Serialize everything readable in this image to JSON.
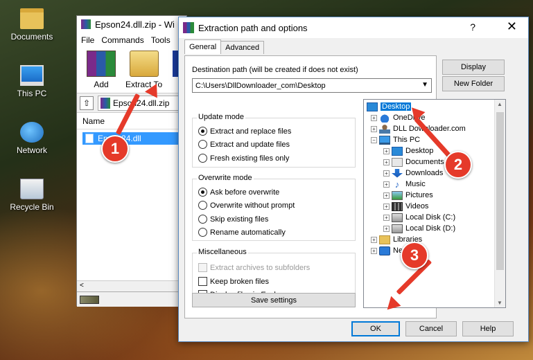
{
  "desktop": {
    "icons": [
      {
        "label": "Documents"
      },
      {
        "label": "This PC"
      },
      {
        "label": "Network"
      },
      {
        "label": "Recycle Bin"
      }
    ]
  },
  "winrar": {
    "title": "Epson24.dll.zip - Wi",
    "menu": [
      "File",
      "Commands",
      "Tools"
    ],
    "toolbar": {
      "add": "Add",
      "extract_to": "Extract To",
      "test": "T"
    },
    "path": "Epson24.dll.zip",
    "column_name": "Name",
    "file": "Epson24.dll",
    "hscroll_left": "<"
  },
  "dialog": {
    "title": "Extraction path and options",
    "help": "?",
    "close": "✕",
    "tabs": [
      "General",
      "Advanced"
    ],
    "dest_label": "Destination path (will be created if does not exist)",
    "dest_value": "C:\\Users\\DllDownloader_com\\Desktop",
    "display_btn": "Display",
    "new_folder_btn": "New Folder",
    "update_mode": {
      "title": "Update mode",
      "options": [
        "Extract and replace files",
        "Extract and update files",
        "Fresh existing files only"
      ],
      "selected": 0
    },
    "overwrite_mode": {
      "title": "Overwrite mode",
      "options": [
        "Ask before overwrite",
        "Overwrite without prompt",
        "Skip existing files",
        "Rename automatically"
      ],
      "selected": 0
    },
    "misc": {
      "title": "Miscellaneous",
      "options": [
        "Extract archives to subfolders",
        "Keep broken files",
        "Display files in Explorer"
      ]
    },
    "save_settings": "Save settings",
    "ok": "OK",
    "cancel": "Cancel",
    "help_btn": "Help",
    "tree": [
      {
        "label": "Desktop",
        "selected": true
      },
      {
        "label": "OneDrive"
      },
      {
        "label": "DLL Downloader.com"
      },
      {
        "label": "This PC"
      },
      {
        "label": "Desktop"
      },
      {
        "label": "Documents"
      },
      {
        "label": "Downloads"
      },
      {
        "label": "Music"
      },
      {
        "label": "Pictures"
      },
      {
        "label": "Videos"
      },
      {
        "label": "Local Disk (C:)"
      },
      {
        "label": "Local Disk (D:)"
      },
      {
        "label": "Libraries"
      },
      {
        "label": "Network"
      }
    ]
  },
  "annotations": {
    "badges": [
      "1",
      "2",
      "3"
    ],
    "color": "#e53a2a"
  }
}
